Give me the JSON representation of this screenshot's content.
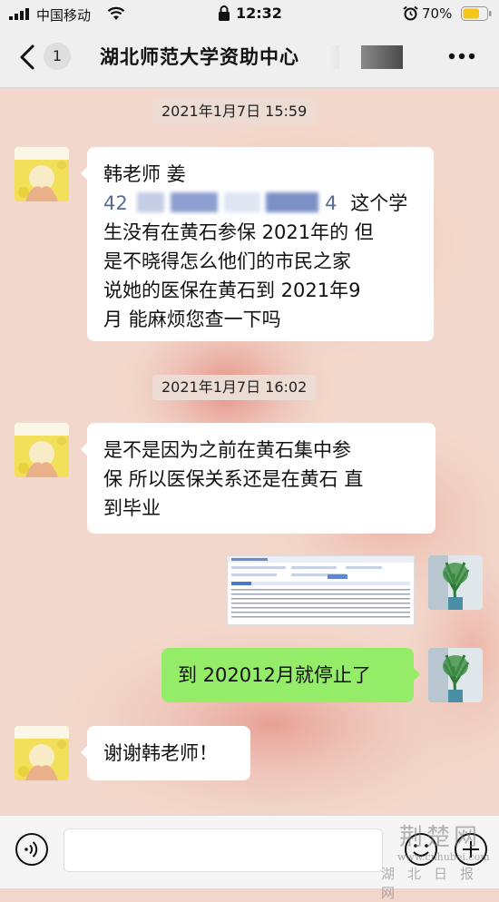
{
  "status_bar": {
    "carrier": "中国移动",
    "time": "12:32",
    "battery_percent": "70%",
    "battery_level": 0.7
  },
  "nav": {
    "back_icon": "chevron-left",
    "unread_count": "1",
    "title": "湖北师范大学资助中心",
    "more_icon": "more-dots"
  },
  "messages": [
    {
      "type": "timestamp",
      "text": "2021年1月7日 15:59"
    },
    {
      "type": "text",
      "side": "left",
      "lines": [
        "韩老师 姜",
        {
          "prefix": "42",
          "redacted": true,
          "suffix_num": "4",
          "suffix_text": "这个学"
        },
        "生没有在黄石参保 2021年的 但",
        "是不晓得怎么他们的市民之家",
        "说她的医保在黄石到 2021年9",
        "月  能麻烦您查一下吗"
      ]
    },
    {
      "type": "timestamp",
      "text": "2021年1月7日 16:02"
    },
    {
      "type": "text",
      "side": "left",
      "lines": [
        "是不是因为之前在黄石集中参",
        "保  所以医保关系还是在黄石 直",
        "到毕业"
      ]
    },
    {
      "type": "image",
      "side": "right",
      "description_icon": "screenshot-thumbnail"
    },
    {
      "type": "text",
      "side": "right",
      "lines": [
        "到 202012月就停止了"
      ]
    },
    {
      "type": "text",
      "side": "left",
      "lines": [
        "谢谢韩老师！"
      ]
    }
  ],
  "input_bar": {
    "voice_icon": "voice",
    "emoji_icon": "smile",
    "plus_icon": "plus"
  },
  "watermark": {
    "logo": "荆楚网",
    "url": "www.cnhubei.com",
    "sub": "湖北日报网"
  },
  "colors": {
    "nav_bg": "#efeff0",
    "chat_bg": "#f1d6c9",
    "bubble_white": "#ffffff",
    "bubble_green": "#95ec69",
    "link_blue": "#576b95"
  }
}
